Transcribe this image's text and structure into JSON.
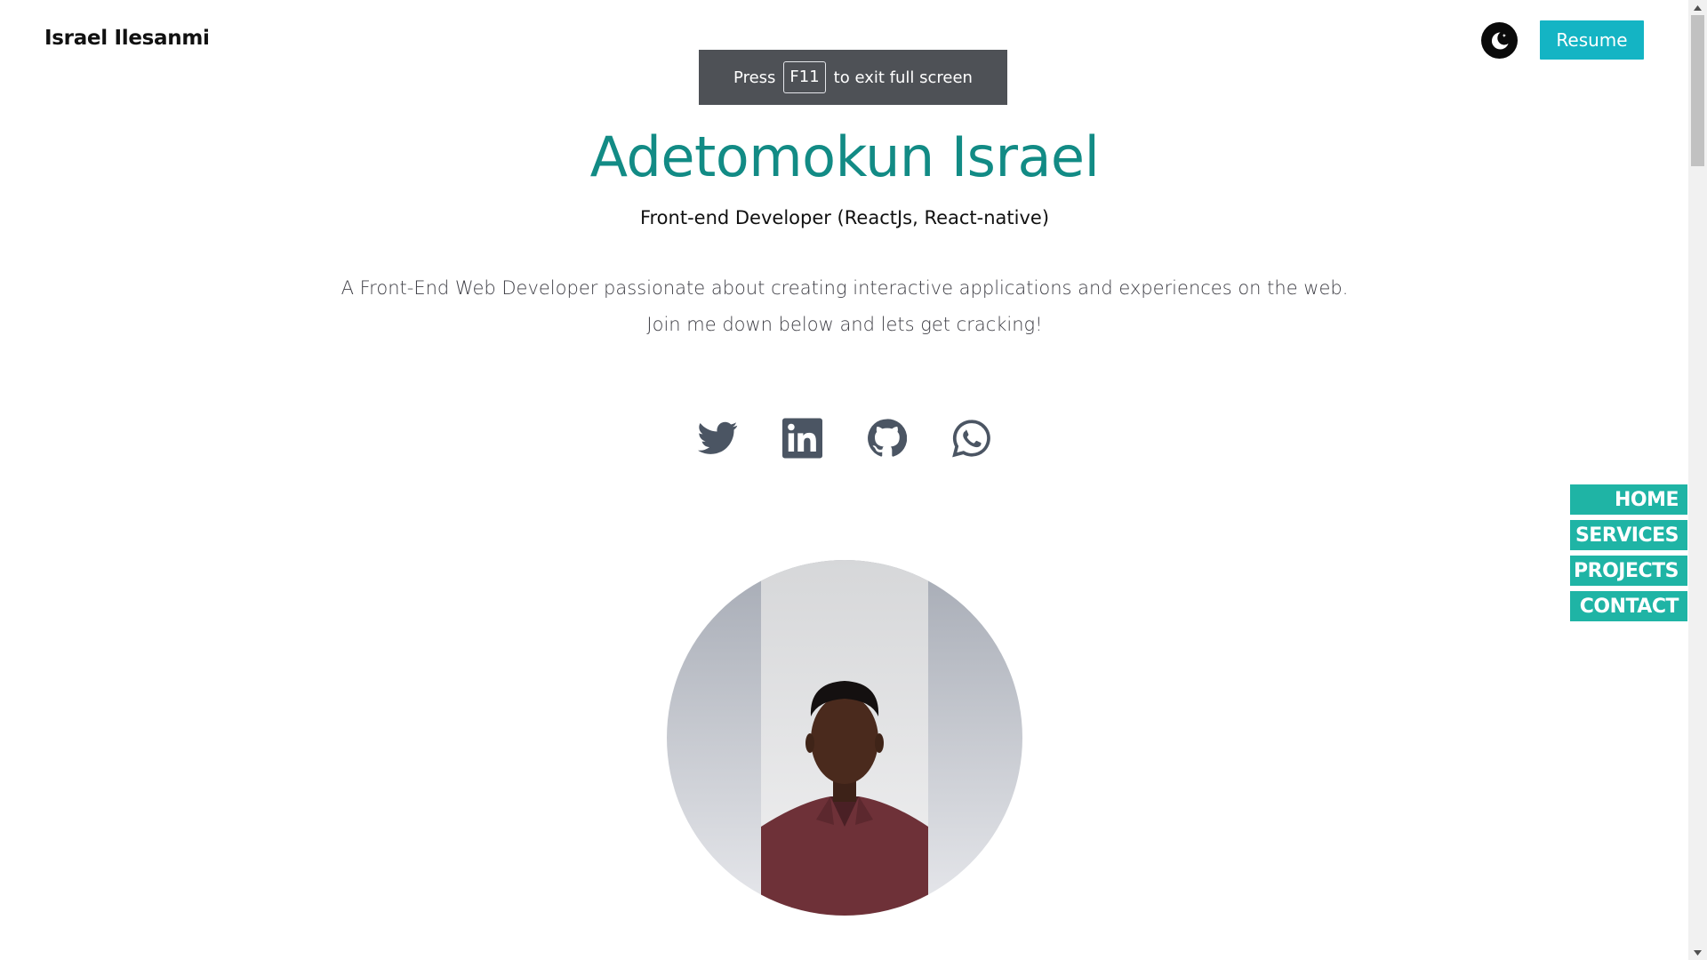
{
  "header": {
    "brand": "Israel Ilesanmi",
    "resume_label": "Resume",
    "theme_toggle_icon": "moon-icon"
  },
  "fullscreen_notice": {
    "prefix": "Press",
    "key": "F11",
    "suffix": "to exit full screen"
  },
  "hero": {
    "name": "Adetomokun Israel",
    "role": "Front-end Developer (ReactJs, React-native)",
    "description_line1": "A Front-End Web Developer passionate about creating interactive applications and experiences on the web.",
    "description_line2": "Join me down below and lets get cracking!"
  },
  "socials": [
    {
      "icon": "twitter-icon"
    },
    {
      "icon": "linkedin-icon"
    },
    {
      "icon": "github-icon"
    },
    {
      "icon": "whatsapp-icon"
    }
  ],
  "side_nav": {
    "items": [
      {
        "label": "HOME"
      },
      {
        "label": "SERVICES"
      },
      {
        "label": "PROJECTS"
      },
      {
        "label": "CONTACT"
      }
    ]
  },
  "colors": {
    "accent_teal": "#128b85",
    "nav_teal": "#1fb4a5",
    "resume_cyan": "#14b4c4",
    "icon_gray": "#4b5563"
  }
}
